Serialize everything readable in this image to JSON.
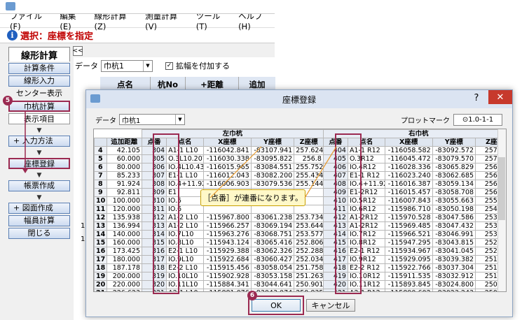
{
  "menu": [
    "ファイル(F)",
    "編集(E)",
    "線形計算(Z)",
    "測量計算(V)",
    "ツール(T)",
    "ヘルプ(H)"
  ],
  "select_bar": {
    "icon": "i",
    "text": "選択：座標を指定"
  },
  "tab_label": "線形計算",
  "collapse_label": "<<",
  "sidebar": {
    "calc_conditions": "計算条件",
    "linear_input": "線形入力",
    "center_display": "センター表示",
    "center_calc": "巾杭計算",
    "display_items": "表示項目",
    "input_method": "+ 入力方法",
    "coord_register": "座標登録",
    "form_create": "帳票作成",
    "drawing_create": "+ 図面作成",
    "width_calc": "幅員計算",
    "close": "閉じる"
  },
  "main": {
    "data_label": "データ",
    "data_value": "巾杭1",
    "expand_label": "拡幅を付加する",
    "expand_checked": "✓",
    "header": [
      "点名",
      "杭No",
      "+距離",
      "追加"
    ],
    "row_numbers": [
      "1",
      "1"
    ]
  },
  "dialog": {
    "title": "座標登録",
    "help": "?",
    "close": "✕",
    "data_label": "データ",
    "data_value": "巾杭1",
    "plot_label": "プロットマーク",
    "plot_value": "⊙1.0-1-1",
    "group_left": "左巾杭",
    "group_right": "右巾杭",
    "columns": [
      "追加距離",
      "点番",
      "点名",
      "X座標",
      "Y座標",
      "Z座標",
      "点番",
      "点名",
      "X座標",
      "Y座標",
      "Z座標"
    ],
    "rows": [
      [
        "4",
        "42.105",
        "304",
        "A1-1 L10",
        "-116042.841",
        "-83107.941",
        "257.624",
        "404",
        "A1-1 R12",
        "-116058.582",
        "-83092.572",
        "257.584"
      ],
      [
        "5",
        "60.000",
        "305",
        "O.3L10.207",
        "-116030.338",
        "-83095.822",
        "256.8",
        "405",
        "O.3R12",
        "-116045.472",
        "-83079.570",
        "257.159"
      ],
      [
        "6",
        "80.000",
        "306",
        "IO.4L10.439",
        "-116015.965",
        "-83084.551",
        "255.752",
        "406",
        "IO.4R12",
        "-116028.336",
        "-83065.829",
        "256.683"
      ],
      [
        "7",
        "85.233",
        "307",
        "E1-1 L10",
        "-116012.043",
        "-83082.200",
        "255.434",
        "407",
        "E1-1 R12",
        "-116023.240",
        "-83062.685",
        "256.559"
      ],
      [
        "8",
        "91.924",
        "308",
        "IO.4+11.924",
        "-116006.903",
        "-83079.536",
        "255.144",
        "408",
        "IO.4+11.924",
        "-116016.387",
        "-83059.134",
        "256.269"
      ],
      [
        "9",
        "92.811",
        "309",
        "E1",
        "",
        "",
        "",
        "409",
        "E1-2R12",
        "-116015.457",
        "-83058.708",
        "256.231"
      ],
      [
        "10",
        "100.000",
        "310",
        "IO.5",
        "",
        "",
        "",
        "410",
        "IO.5R12",
        "-116007.843",
        "-83055.663",
        "255.780"
      ],
      [
        "11",
        "120.000",
        "311",
        "IO.6",
        "",
        "",
        "",
        "411",
        "IO.6R12",
        "-115986.710",
        "-83050.198",
        "254.619"
      ],
      [
        "12",
        "135.938",
        "312",
        "A1-2 L10",
        "-115967.800",
        "-83061.238",
        "253.734",
        "412",
        "A1-2R12",
        "-115970.528",
        "-83047.586",
        "253.694"
      ],
      [
        "13",
        "136.994",
        "313",
        "A1-2 L10",
        "-115966.257",
        "-83069.194",
        "253.644",
        "413",
        "A1-2R12",
        "-115969.485",
        "-83047.432",
        "253.653"
      ],
      [
        "14",
        "140.000",
        "314",
        "IO.7L10",
        "-115963.276",
        "-83068.751",
        "253.577",
        "414",
        "IO.7R12",
        "-115966.521",
        "-83046.991",
        "253.537"
      ],
      [
        "15",
        "160.000",
        "315",
        "IO.8L10",
        "-115943.124",
        "-83065.416",
        "252.806",
        "415",
        "IO.8R12",
        "-115947.295",
        "-83043.815",
        "252.766"
      ],
      [
        "16",
        "173.425",
        "316",
        "E2-1 L10",
        "-115929.388",
        "-83062.326",
        "252.288",
        "416",
        "E2-1 R12",
        "-115934.967",
        "-83041.045",
        "252.248"
      ],
      [
        "17",
        "180.000",
        "317",
        "IO.9L10",
        "-115922.684",
        "-83060.427",
        "252.034",
        "417",
        "IO.9R12",
        "-115929.095",
        "-83039.382",
        "251.994"
      ],
      [
        "18",
        "187.178",
        "318",
        "E2-2 L10",
        "-115915.456",
        "-83058.054",
        "251.758",
        "418",
        "E2-2 R12",
        "-115922.766",
        "-83037.304",
        "251.718"
      ],
      [
        "19",
        "200.000",
        "319",
        "IO.10L10",
        "-115902.928",
        "-83053.158",
        "251.263",
        "419",
        "IO.10R12",
        "-115911.535",
        "-83032.912",
        "251.223"
      ],
      [
        "20",
        "220.000",
        "320",
        "IO.11L10",
        "-115884.341",
        "-83044.641",
        "250.901",
        "420",
        "IO.11R12",
        "-115893.845",
        "-83024.800",
        "250.861"
      ],
      [
        "21",
        "226.623",
        "321",
        "A2-1 L10",
        "-115881.076",
        "-83043.074",
        "250.835",
        "421",
        "A2-1 R12",
        "-115890.602",
        "-83023.243",
        "250.795"
      ],
      [
        "22",
        "240.000",
        "322",
        "IO.12L10",
        "-115866.302",
        "-83035.978",
        "250.482",
        "422",
        "IO.12R12",
        "-115875.828",
        "-83016.147",
        "250.442"
      ]
    ],
    "callout": "［点番］が連番になります。",
    "ok": "OK",
    "cancel": "キャンセル"
  },
  "badges": {
    "five": "5",
    "six": "6"
  }
}
